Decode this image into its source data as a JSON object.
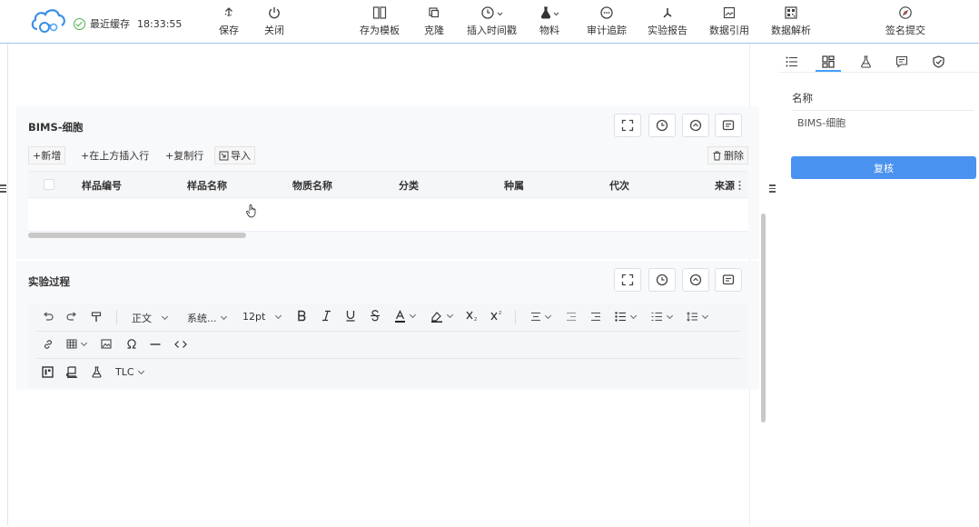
{
  "topbar": {
    "autosave_label": "最近缓存",
    "autosave_time": "18:33:55",
    "buttons": {
      "save": "保存",
      "close": "关闭",
      "save_template": "存为模板",
      "clone": "克隆",
      "insert_time": "插入时间戳",
      "material": "物料",
      "audit": "审计追踪",
      "report": "实验报告",
      "data_ref": "数据引用",
      "data_parse": "数据解析",
      "sign_submit": "签名提交"
    }
  },
  "bims_section": {
    "title": "BIMS-细胞",
    "toolbar": {
      "add": "+新增",
      "insert_above": "+在上方插入行",
      "copy_row": "+复制行",
      "import": "导入",
      "delete": "删除"
    },
    "columns": [
      "样品编号",
      "样品名称",
      "物质名称",
      "分类",
      "种属",
      "代次",
      "来源"
    ]
  },
  "process_section": {
    "title": "实验过程",
    "editor": {
      "paragraph": "正文",
      "font_family": "系统...",
      "font_size": "12pt",
      "tlc": "TLC"
    }
  },
  "right_panel": {
    "name_label": "名称",
    "name_value": "BIMS-细胞",
    "review_button": "复核"
  },
  "colors": {
    "accent": "#409eff",
    "button_blue": "#4a92f0",
    "success": "#4caf50"
  }
}
